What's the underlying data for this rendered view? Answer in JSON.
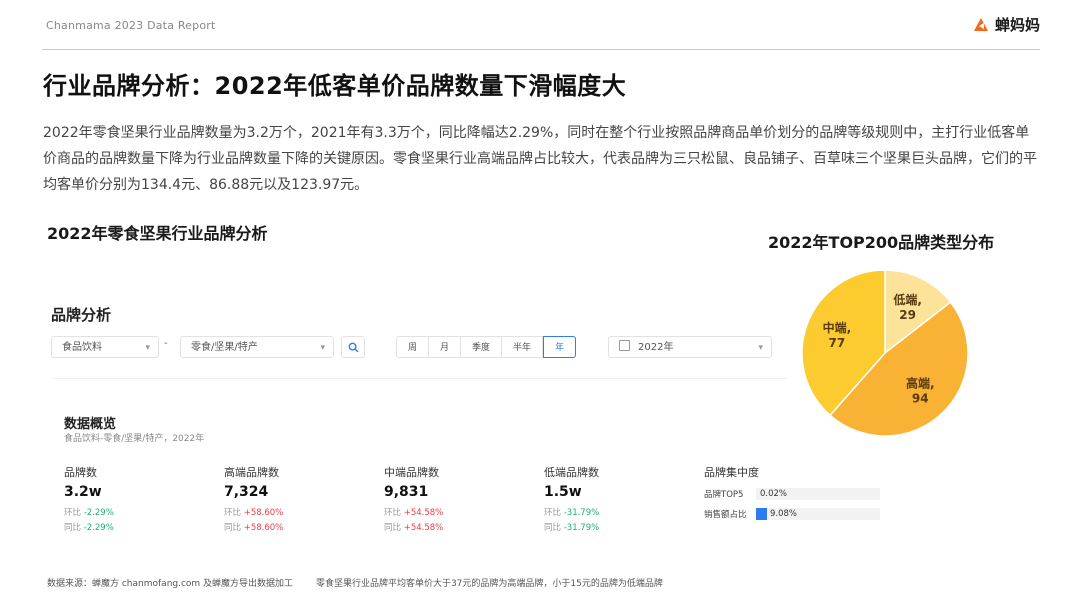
{
  "header": {
    "report_label": "Chanmama 2023 Data Report",
    "logo_text": "蝉妈妈",
    "accent_color": "#f26a1b"
  },
  "page": {
    "title": "行业品牌分析：2022年低客单价品牌数量下滑幅度大",
    "intro": "2022年零食坚果行业品牌数量为3.2万个，2021年有3.3万个，同比降幅达2.29%，同时在整个行业按照品牌商品单价划分的品牌等级规则中，主打行业低客单价商品的品牌数量下降为行业品牌数量下降的关键原因。零食坚果行业高端品牌占比较大，代表品牌为三只松鼠、良品铺子、百草味三个坚果巨头品牌，它们的平均客单价分别为134.4元、86.88元以及123.97元。"
  },
  "left_section": {
    "title": "2022年零食坚果行业品牌分析"
  },
  "panel": {
    "title": "品牌分析",
    "filters": {
      "category": "食品饮料",
      "dash": "-",
      "subcategory": "零食/坚果/特产",
      "date": "2022年"
    },
    "periods": [
      "周",
      "月",
      "季度",
      "半年",
      "年"
    ],
    "active_period": "年",
    "overview_title": "数据概览",
    "overview_sub": "食品饮料-零食/坚果/特产，2022年",
    "metrics": [
      {
        "label": "品牌数",
        "value": "3.2w",
        "mom_label": "环比",
        "mom": "-2.29%",
        "yoy_label": "同比",
        "yoy": "-2.29%"
      },
      {
        "label": "高端品牌数",
        "value": "7,324",
        "mom_label": "环比",
        "mom": "+58.60%",
        "yoy_label": "同比",
        "yoy": "+58.60%"
      },
      {
        "label": "中端品牌数",
        "value": "9,831",
        "mom_label": "环比",
        "mom": "+54.58%",
        "yoy_label": "同比",
        "yoy": "+54.58%"
      },
      {
        "label": "低端品牌数",
        "value": "1.5w",
        "mom_label": "环比",
        "mom": "-31.79%",
        "yoy_label": "同比",
        "yoy": "-31.79%"
      }
    ],
    "concentration": {
      "label": "品牌集中度",
      "rows": [
        {
          "label": "品牌TOP5",
          "value": "0.02%",
          "fraction": 0.0002
        },
        {
          "label": "销售额占比",
          "value": "9.08%",
          "fraction": 0.0908
        }
      ]
    },
    "status_colors": {
      "up": "#f0393f",
      "down": "#1ab26b",
      "active": "#2b7bf3"
    }
  },
  "right_section": {
    "title": "2022年TOP200品牌类型分布"
  },
  "chart_data": {
    "type": "pie",
    "title": "2022年TOP200品牌类型分布",
    "slices": [
      {
        "label": "低端,",
        "value": 29,
        "color": "#fde39a"
      },
      {
        "label": "高端,",
        "value": 94,
        "color": "#f9b234"
      },
      {
        "label": "中端,",
        "value": 77,
        "color": "#fccb2f"
      }
    ]
  },
  "footer": {
    "source": "数据来源：蝉魔方 chanmofang.com 及蝉魔方导出数据加工",
    "note": "零食坚果行业品牌平均客单价大于37元的品牌为高端品牌，小于15元的品牌为低端品牌"
  }
}
